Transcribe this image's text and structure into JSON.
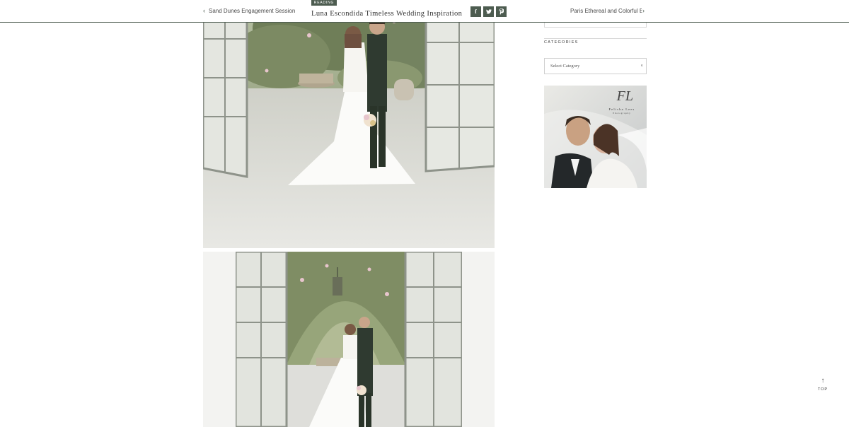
{
  "header": {
    "prev_label": "Sand Dunes Engagement Session",
    "next_label": "Paris Ethereal and Colorful Boho",
    "reading_badge": "Reading",
    "post_title": "Luna Escondida Timeless Wedding Inspiration",
    "share_icons": [
      "facebook-icon",
      "twitter-icon",
      "pinterest-icon"
    ],
    "accent": "#4d5c50"
  },
  "sidebar": {
    "categories_title": "Categories",
    "category_select_value": "Select Category"
  },
  "ad": {
    "monogram": "FL",
    "brand": "Felisha Lees",
    "brand_sub": "Photography"
  },
  "back_to_top": "Top"
}
